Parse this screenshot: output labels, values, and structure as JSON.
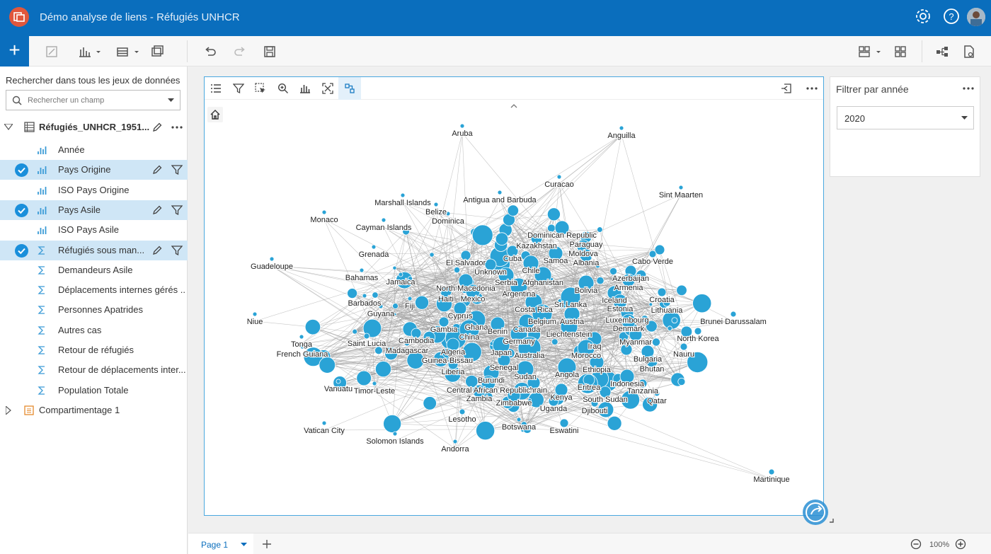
{
  "header": {
    "title": "Démo analyse de liens - Réfugiés UNHCR"
  },
  "left_pane": {
    "search_caption": "Rechercher dans tous les jeux de données",
    "search_placeholder": "Rechercher un champ",
    "dataset_name": "Réfugiés_UNHCR_1951...",
    "fields": [
      {
        "label": "Année",
        "type": "string",
        "selected": false
      },
      {
        "label": "Pays Origine",
        "type": "string",
        "selected": true
      },
      {
        "label": "ISO Pays Origine",
        "type": "string",
        "selected": false
      },
      {
        "label": "Pays Asile",
        "type": "string",
        "selected": true
      },
      {
        "label": "ISO Pays Asile",
        "type": "string",
        "selected": false
      },
      {
        "label": "Réfugiés sous man...",
        "type": "number",
        "selected": true
      },
      {
        "label": "Demandeurs Asile",
        "type": "number",
        "selected": false
      },
      {
        "label": "Déplacements internes gérés ...",
        "type": "number",
        "selected": false
      },
      {
        "label": "Personnes Apatrides",
        "type": "number",
        "selected": false
      },
      {
        "label": "Autres cas",
        "type": "number",
        "selected": false
      },
      {
        "label": "Retour de réfugiés",
        "type": "number",
        "selected": false
      },
      {
        "label": "Retour de déplacements inter...",
        "type": "number",
        "selected": false
      },
      {
        "label": "Population Totale",
        "type": "number",
        "selected": false
      }
    ],
    "binning_name": "Compartimentage 1"
  },
  "filter_card": {
    "title": "Filtrer par année",
    "selected_value": "2020"
  },
  "bottom": {
    "page_label": "Page 1",
    "zoom": "100%"
  },
  "graph": {
    "node_color": "#2aa3d6",
    "edge_color": "#9a9a9a",
    "labels": [
      "Aruba",
      "Anguilla",
      "Curacao",
      "Sint Maarten",
      "Antigua and Barbuda",
      "Marshall Islands",
      "Belize",
      "Dominica",
      "Monaco",
      "Cayman Islands",
      "Dominican Republic",
      "Kazakhstan",
      "Paraguay",
      "Moldova",
      "Cabo Verde",
      "Grenada",
      "El Salvador",
      "Cuba",
      "Samoa",
      "Albania",
      "Guadeloupe",
      "Chile",
      "Unknown",
      "Bahamas",
      "Jamaica",
      "Afghanistan",
      "Serbia",
      "Azerbaijan",
      "North Macedonia",
      "Armenia",
      "Bolivia",
      "Argentina",
      "Croatia",
      "Barbados",
      "Fiji",
      "Haiti",
      "Mexico",
      "Sri Lanka",
      "Iceland",
      "Lithuania",
      "Guyana",
      "Costa Rica",
      "Estonia",
      "Niue",
      "Cyprus",
      "Belgium",
      "Austria",
      "Luxembourg",
      "Brunei Darussalam",
      "Ghana",
      "Canada",
      "Denmark",
      "Gambia",
      "Benin",
      "Liechtenstein",
      "Tonga",
      "Saint Lucia",
      "China",
      "Cambodia",
      "Germany",
      "Iraq",
      "Myanmar",
      "North Korea",
      "French Guiana",
      "Madagascar",
      "Algeria",
      "Japan",
      "Australia",
      "Morocco",
      "Bulgaria",
      "Nauru",
      "Guinea-Bissau",
      "Senegal",
      "Ethiopia",
      "Bhutan",
      "Liberia",
      "Sudan",
      "Angola",
      "Burundi",
      "Bahrain",
      "Eritrea",
      "Indonesia",
      "Vanuatu",
      "Timor-Leste",
      "Central African Republic",
      "Kenya",
      "South Sudan",
      "Tanzania",
      "Zambia",
      "Zimbabwe",
      "Uganda",
      "Djibouti",
      "Qatar",
      "Lesotho",
      "Botswana",
      "Vatican City",
      "Eswatini",
      "Solomon Islands",
      "Andorra",
      "Martinique"
    ]
  }
}
